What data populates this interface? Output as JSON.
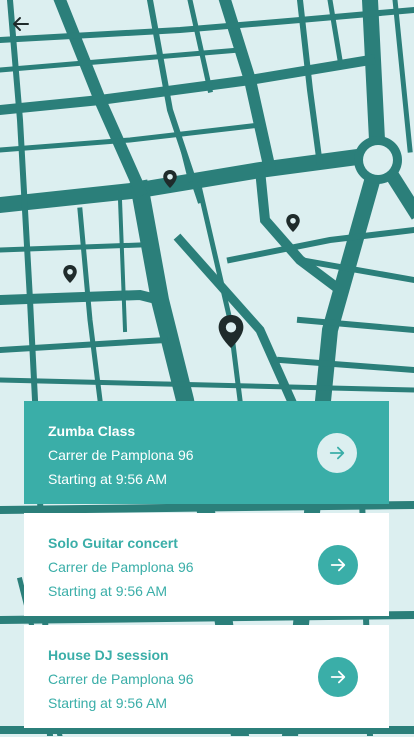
{
  "colors": {
    "accent": "#3aaea8",
    "map_roads": "#2b7f7a",
    "map_background": "#dceff0",
    "pin": "#1f2b2b"
  },
  "map": {
    "back_icon": "arrow-left-icon",
    "pin_icon": "map-pin-icon"
  },
  "events": [
    {
      "title": "Zumba Class",
      "address": "Carrer de Pamplona 96",
      "time": "Starting at 9:56 AM",
      "action_icon": "arrow-right-icon",
      "selected": true
    },
    {
      "title": "Solo Guitar concert",
      "address": "Carrer de Pamplona 96",
      "time": "Starting at 9:56 AM",
      "action_icon": "arrow-right-icon",
      "selected": false
    },
    {
      "title": "House DJ session",
      "address": "Carrer de Pamplona 96",
      "time": "Starting at 9:56 AM",
      "action_icon": "arrow-right-icon",
      "selected": false
    }
  ]
}
